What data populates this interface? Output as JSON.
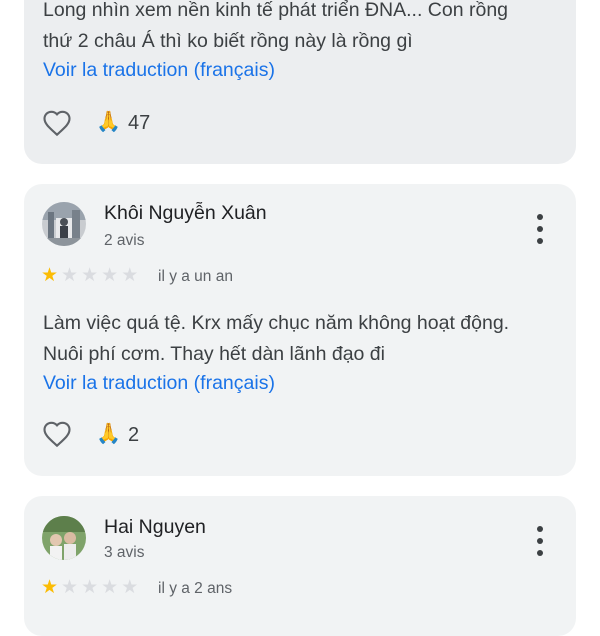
{
  "reviews": [
    {
      "text_lines": [
        "Long nhìn xem nền kinh tế phát triển ĐNA... Con rồng",
        "thứ 2 châu Á thì ko biết rồng này là rồng gì"
      ],
      "translate_link": "Voir la traduction (français)",
      "like_icon": "heart-outline-icon",
      "reaction_icon": "🙏",
      "reaction_count": "47"
    },
    {
      "author": "Khôi Nguyễn Xuân",
      "review_count": "2 avis",
      "rating": 1,
      "max_rating": 5,
      "date": "il y a un an",
      "text_lines": [
        "Làm việc quá tệ. Krx mấy chục năm không hoạt động.",
        "Nuôi phí cơm. Thay hết dàn lãnh đạo đi"
      ],
      "translate_link": "Voir la traduction (français)",
      "like_icon": "heart-outline-icon",
      "reaction_icon": "🙏",
      "reaction_count": "2",
      "menu_icon": "more-vertical-icon"
    },
    {
      "author": "Hai Nguyen",
      "review_count": "3 avis",
      "rating": 1,
      "max_rating": 5,
      "date": "il y a 2 ans",
      "menu_icon": "more-vertical-icon"
    }
  ],
  "colors": {
    "card_bg": "#f1f3f4",
    "link": "#1a73e8",
    "star_filled": "#fbbc04",
    "star_empty": "#dadce0"
  }
}
